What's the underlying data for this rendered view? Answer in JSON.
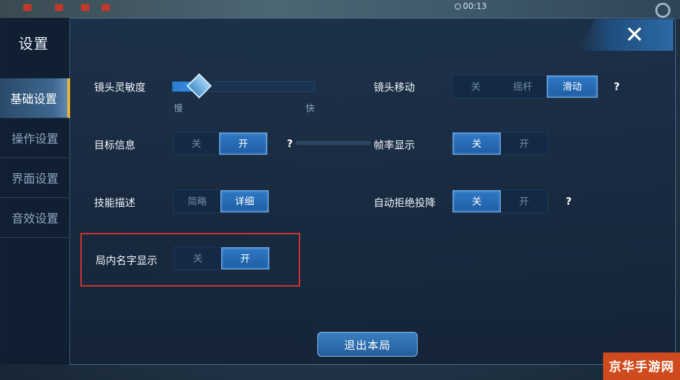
{
  "hud": {
    "timer": "00:13"
  },
  "panel": {
    "title": "设置",
    "close_icon": "close-x-icon",
    "tabs": [
      {
        "label": "基础设置",
        "active": true
      },
      {
        "label": "操作设置",
        "active": false
      },
      {
        "label": "界面设置",
        "active": false
      },
      {
        "label": "音效设置",
        "active": false
      }
    ]
  },
  "settings": {
    "camera_sensitivity": {
      "label": "镜头灵敏度",
      "min_label": "慢",
      "max_label": "快",
      "level": 0.2
    },
    "camera_move": {
      "label": "镜头移动",
      "options": [
        "关",
        "摇杆",
        "滑动"
      ],
      "selected": "滑动",
      "help": "?"
    },
    "target_info": {
      "label": "目标信息",
      "options": [
        "关",
        "开"
      ],
      "selected": "开",
      "help": "?"
    },
    "fps_display": {
      "label": "帧率显示",
      "options": [
        "关",
        "开"
      ],
      "selected": "关"
    },
    "skill_desc": {
      "label": "技能描述",
      "options": [
        "简略",
        "详细"
      ],
      "selected": "详细"
    },
    "auto_reject_surrender": {
      "label": "自动拒绝投降",
      "options": [
        "关",
        "开"
      ],
      "selected": "关",
      "help": "?"
    },
    "name_display": {
      "label": "局内名字显示",
      "options": [
        "关",
        "开"
      ],
      "selected": "开"
    }
  },
  "exit_button": "退出本局",
  "watermark": "京华手游网",
  "colors": {
    "accent": "#2f78c4",
    "tab_indicator": "#f0b43c",
    "highlight_box": "#d4332e",
    "watermark_bg": "#cf4a1c"
  }
}
